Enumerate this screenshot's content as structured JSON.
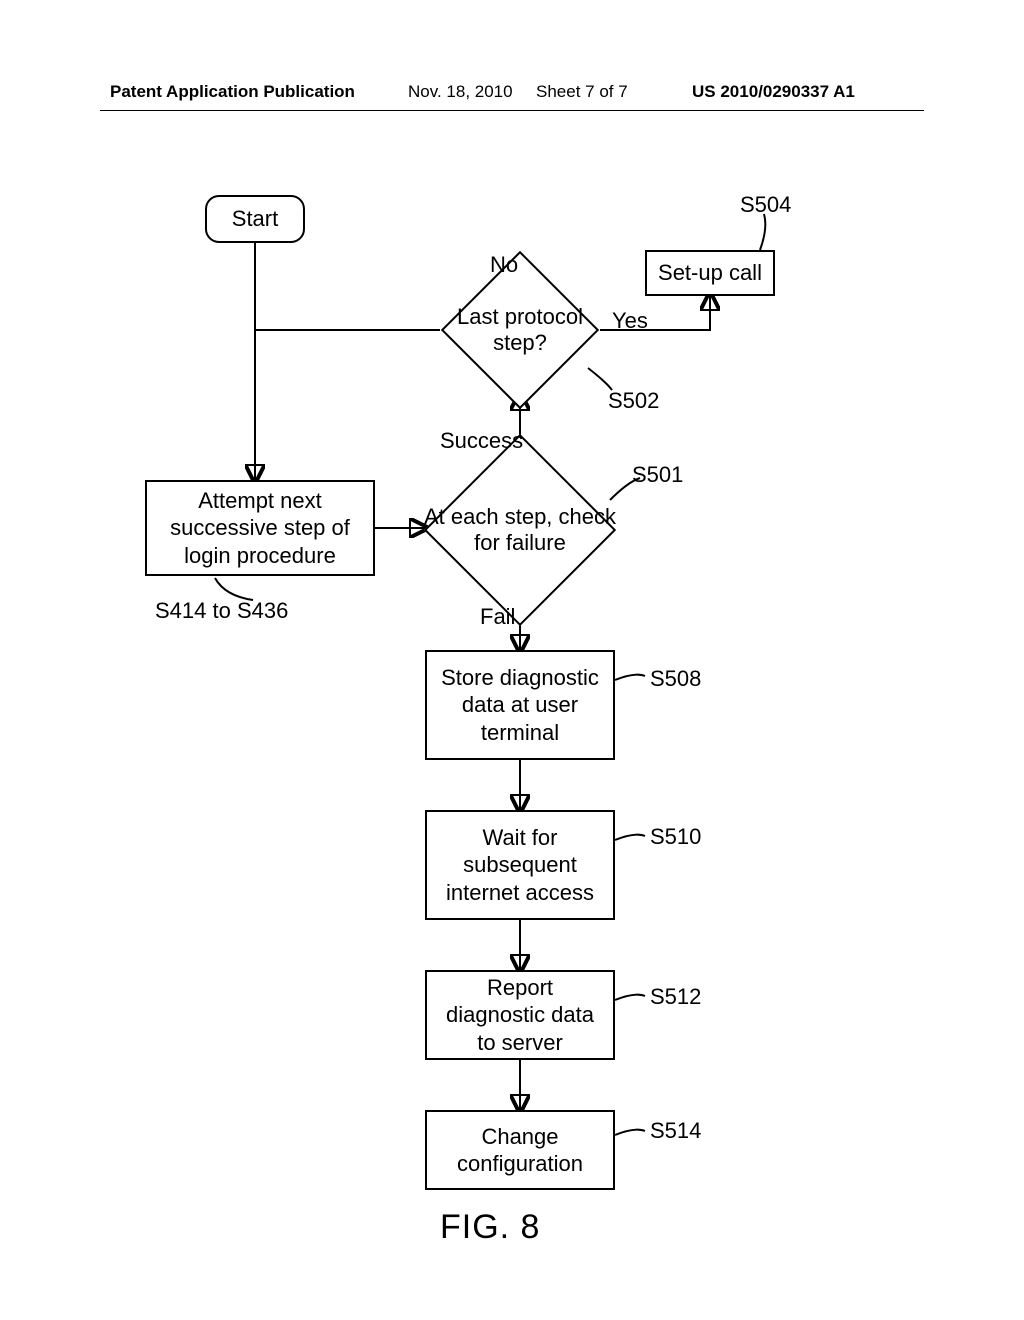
{
  "header": {
    "pub": "Patent Application Publication",
    "date": "Nov. 18, 2010",
    "sheet": "Sheet 7 of 7",
    "patno": "US 2010/0290337 A1"
  },
  "nodes": {
    "start": "Start",
    "attempt": "Attempt next successive step of login procedure",
    "check": "At each step, check for failure",
    "last": "Last protocol step?",
    "setup": "Set-up call",
    "store": "Store diagnostic data at user terminal",
    "wait": "Wait for subsequent internet access",
    "report": "Report diagnostic data to server",
    "change": "Change configuration"
  },
  "edges": {
    "success": "Success",
    "fail": "Fail",
    "no": "No",
    "yes": "Yes"
  },
  "refs": {
    "s414": "S414 to S436",
    "s501": "S501",
    "s502": "S502",
    "s504": "S504",
    "s508": "S508",
    "s510": "S510",
    "s512": "S512",
    "s514": "S514"
  },
  "figure": "FIG. 8"
}
